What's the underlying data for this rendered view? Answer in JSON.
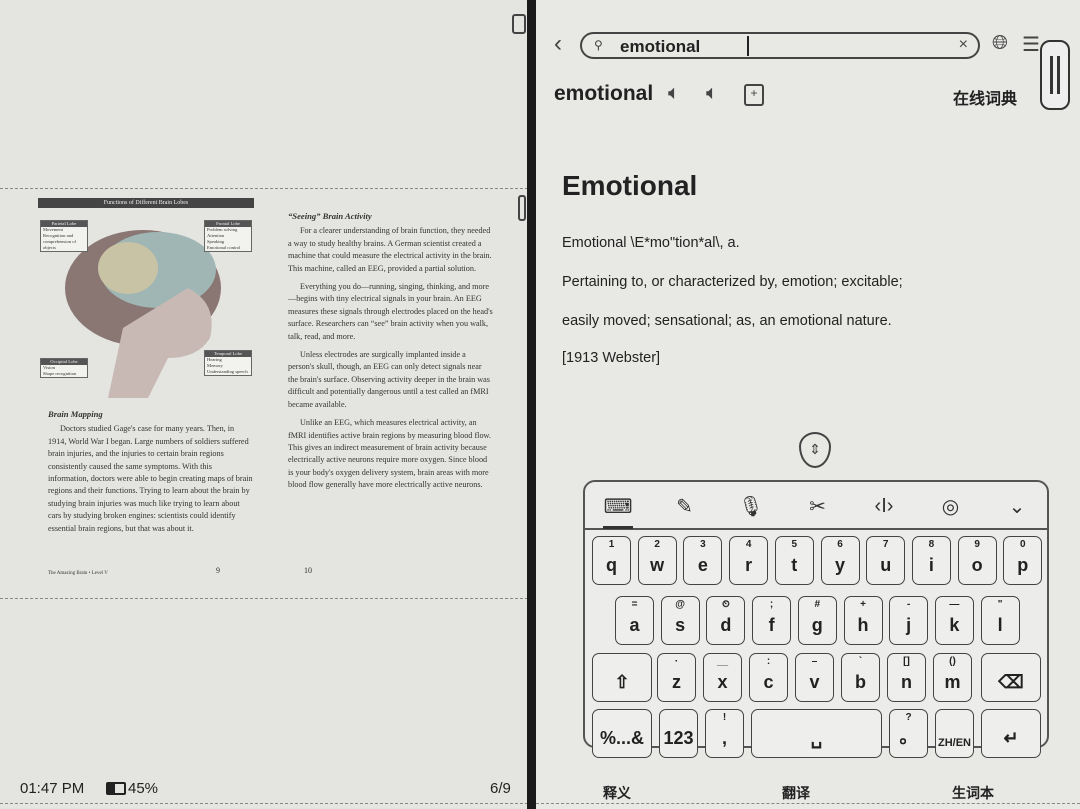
{
  "reader": {
    "diagram": {
      "title": "Functions of Different Brain Lobes",
      "lobes": [
        {
          "name": "Parietal Lobe",
          "items": [
            "Movement",
            "Recognition and comprehension of objects"
          ]
        },
        {
          "name": "Frontal Lobe",
          "items": [
            "Problem solving",
            "Attention",
            "Speaking",
            "Emotional control"
          ]
        },
        {
          "name": "Occipital Lobe",
          "items": [
            "Vision",
            "Shape recognition"
          ]
        },
        {
          "name": "Temporal Lobe",
          "items": [
            "Hearing",
            "Memory",
            "Understanding speech"
          ]
        }
      ]
    },
    "left_col": {
      "heading": "Brain Mapping",
      "paragraphs": [
        "Doctors studied Gage's case for many years. Then, in 1914, World War I began. Large numbers of soldiers suffered brain injuries, and the injuries to certain brain regions consistently caused the same symptoms. With this information, doctors were able to begin creating maps of brain regions and their functions. Trying to learn about the brain by studying brain injuries was much like trying to learn about cars by studying broken engines: scientists could identify essential brain regions, but that was about it."
      ]
    },
    "right_col": {
      "heading": "“Seeing” Brain Activity",
      "paragraphs": [
        "For a clearer understanding of brain function, they needed a way to study healthy brains. A German scientist created a machine that could measure the electrical activity in the brain. This machine, called an EEG, provided a partial solution.",
        "Everything you do—running, singing, thinking, and more—begins with tiny electrical signals in your brain. An EEG measures these signals through electrodes placed on the head's surface. Researchers can “see” brain activity when you walk, talk, read, and more.",
        "Unless electrodes are surgically implanted inside a person's skull, though, an EEG can only detect signals near the brain's surface. Observing activity deeper in the brain was difficult and potentially dangerous until a test called an fMRI became available.",
        "Unlike an EEG, which measures electrical activity, an fMRI identifies active brain regions by measuring blood flow. This gives an indirect measurement of brain activity because electrically active neurons require more oxygen. Since blood is your body's oxygen delivery system, brain areas with more blood flow generally have more electrically active neurons."
      ]
    },
    "footer_left": "The Amazing Brain • Level V",
    "page_left": "9",
    "page_right": "10",
    "status": {
      "time": "01:47 PM",
      "battery": "45%",
      "battery_level": 0.45,
      "page": "6/9"
    }
  },
  "dict": {
    "search_value": "emotional",
    "headword": "emotional",
    "source": "在线词典",
    "title": "Emotional",
    "lines": [
      "Emotional \\E*mo\"tion*al\\, a.",
      "Pertaining to, or characterized by, emotion; excitable;",
      "easily moved; sensational; as, an emotional nature.",
      "[1913 Webster]"
    ],
    "tabs": [
      "释义",
      "翻译",
      "生词本"
    ]
  },
  "keyboard": {
    "tools": [
      "keyboard-icon",
      "handwriting-icon",
      "microphone-icon",
      "clipboard-scissors-icon",
      "cursor-move-icon",
      "settings-icon",
      "collapse-keyboard-icon"
    ],
    "row1": [
      [
        "1",
        "q"
      ],
      [
        "2",
        "w"
      ],
      [
        "3",
        "e"
      ],
      [
        "4",
        "r"
      ],
      [
        "5",
        "t"
      ],
      [
        "6",
        "y"
      ],
      [
        "7",
        "u"
      ],
      [
        "8",
        "i"
      ],
      [
        "9",
        "o"
      ],
      [
        "0",
        "p"
      ]
    ],
    "row2": [
      [
        "=",
        "a"
      ],
      [
        "@",
        "s"
      ],
      [
        "⏲",
        "d"
      ],
      [
        ";",
        "f"
      ],
      [
        "#",
        "g"
      ],
      [
        "+",
        "h"
      ],
      [
        "-",
        "j"
      ],
      [
        "—",
        "k"
      ],
      [
        "\"",
        "l"
      ]
    ],
    "row3": [
      [
        "·",
        "z"
      ],
      [
        "__",
        "x"
      ],
      [
        ":",
        "c"
      ],
      [
        "–",
        "v"
      ],
      [
        "`",
        "b"
      ],
      [
        "[]",
        "n"
      ],
      [
        "()",
        "m"
      ]
    ],
    "shift": "⇧",
    "backspace": "⌫",
    "row4": {
      "symbols": "%...&",
      "numbers": "123",
      "comma": [
        "!",
        ","
      ],
      "space": "␣",
      "period": [
        "?",
        "。"
      ],
      "lang": "ZH/EN",
      "enter": "↵"
    }
  }
}
